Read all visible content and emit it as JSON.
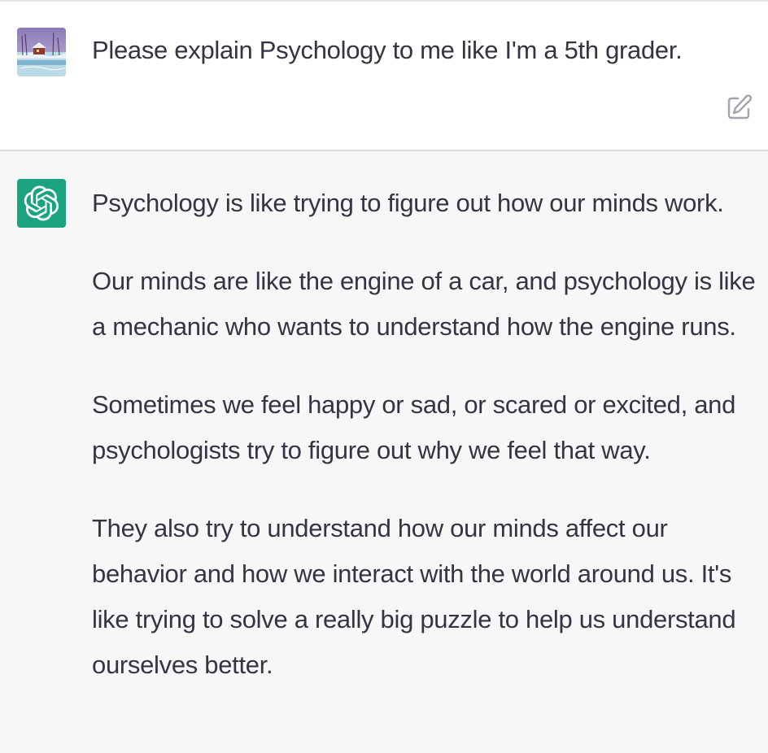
{
  "user_message": {
    "text": "Please explain Psychology to me like I'm a 5th grader.",
    "avatar_icon": "winter-landscape-avatar"
  },
  "assistant_message": {
    "avatar_icon": "openai-logo-icon",
    "avatar_color": "#19a37f",
    "paragraphs": [
      "Psychology is like trying to figure out how our minds work.",
      "Our minds are like the engine of a car, and psychology is like a mechanic who wants to understand how the engine runs.",
      "Sometimes we feel happy or sad, or scared or excited, and psychologists try to figure out why we feel that way.",
      "They also try to understand how our minds affect our behavior and how we interact with the world around us. It's like trying to solve a really big puzzle to help us understand ourselves better."
    ]
  },
  "actions": {
    "edit_icon": "edit-icon"
  }
}
